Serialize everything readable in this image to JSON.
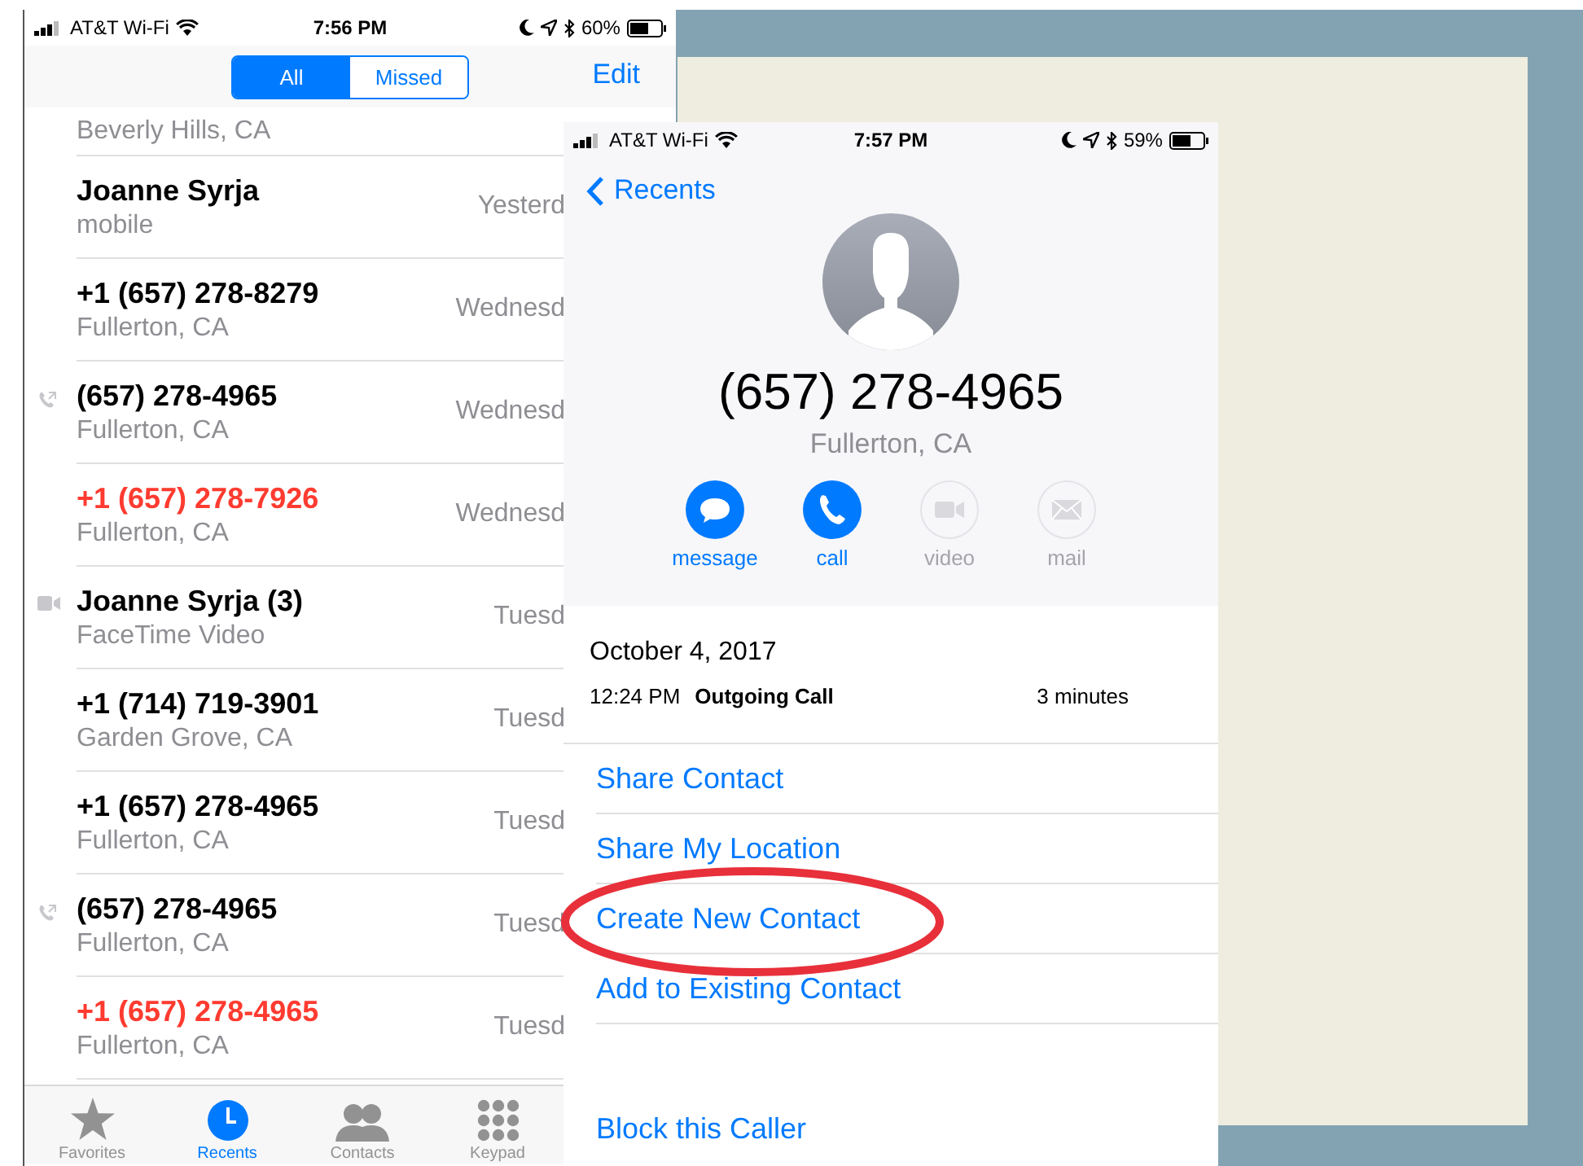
{
  "recents_screen": {
    "status_bar": {
      "carrier": "AT&T Wi-Fi",
      "time": "7:56 PM",
      "battery": "60%"
    },
    "segments": [
      {
        "label": "All",
        "selected": true
      },
      {
        "label": "Missed",
        "selected": false
      }
    ],
    "edit_button": "Edit",
    "partial_row_subtitle": "Beverly Hills, CA",
    "rows": [
      {
        "name": "Joanne Syrja",
        "subtitle": "mobile",
        "time": "Yesterd",
        "missed": false,
        "kind": "none"
      },
      {
        "name": "+1 (657) 278-8279",
        "subtitle": "Fullerton, CA",
        "time": "Wednesd",
        "missed": false,
        "kind": "none"
      },
      {
        "name": "(657) 278-4965",
        "subtitle": "Fullerton, CA",
        "time": "Wednesd",
        "missed": false,
        "kind": "outgoing"
      },
      {
        "name": "+1 (657) 278-7926",
        "subtitle": "Fullerton, CA",
        "time": "Wednesd",
        "missed": true,
        "kind": "none"
      },
      {
        "name": "Joanne Syrja (3)",
        "subtitle": "FaceTime Video",
        "time": "Tuesd",
        "missed": false,
        "kind": "video"
      },
      {
        "name": "+1 (714) 719-3901",
        "subtitle": "Garden Grove, CA",
        "time": "Tuesd",
        "missed": false,
        "kind": "none"
      },
      {
        "name": "+1 (657) 278-4965",
        "subtitle": "Fullerton, CA",
        "time": "Tuesd",
        "missed": false,
        "kind": "none"
      },
      {
        "name": "(657) 278-4965",
        "subtitle": "Fullerton, CA",
        "time": "Tuesd",
        "missed": false,
        "kind": "outgoing"
      },
      {
        "name": "+1 (657) 278-4965",
        "subtitle": "Fullerton, CA",
        "time": "Tuesd",
        "missed": true,
        "kind": "none"
      }
    ],
    "tab_bar": [
      {
        "label": "Favorites",
        "kind": "star",
        "selected": false
      },
      {
        "label": "Recents",
        "kind": "clock",
        "selected": true
      },
      {
        "label": "Contacts",
        "kind": "people",
        "selected": false
      },
      {
        "label": "Keypad",
        "kind": "keypad",
        "selected": false
      }
    ]
  },
  "detail_screen": {
    "status_bar": {
      "carrier": "AT&T Wi-Fi",
      "time": "7:57 PM",
      "battery": "59%"
    },
    "back_button": "Recents",
    "number": "(657) 278-4965",
    "location": "Fullerton, CA",
    "actions": [
      {
        "label": "message",
        "kind": "message",
        "disabled": false
      },
      {
        "label": "call",
        "kind": "call",
        "disabled": false
      },
      {
        "label": "video",
        "kind": "video",
        "disabled": true
      },
      {
        "label": "mail",
        "kind": "mail",
        "disabled": true
      }
    ],
    "call_date": "October 4, 2017",
    "call_time": "12:24 PM",
    "call_type": "Outgoing Call",
    "call_duration": "3 minutes",
    "options": [
      {
        "label": "Share Contact",
        "circled": false
      },
      {
        "label": "Share My Location",
        "circled": false
      },
      {
        "label": "Create New Contact",
        "circled": true
      },
      {
        "label": "Add to Existing Contact",
        "circled": false
      }
    ],
    "block_button": "Block this Caller"
  }
}
